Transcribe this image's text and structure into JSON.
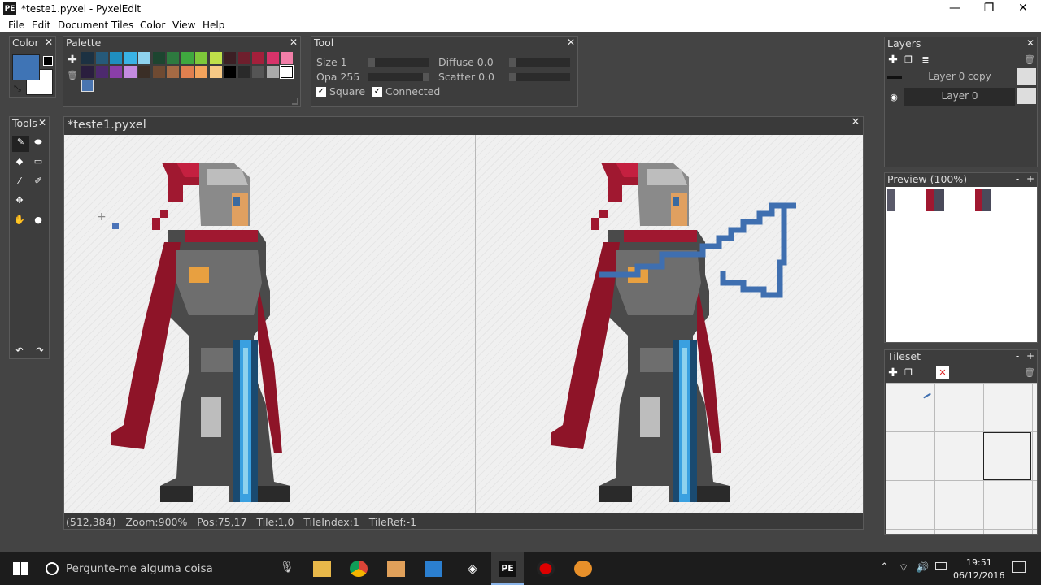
{
  "window": {
    "title": "*teste1.pyxel - PyxelEdit",
    "logo": "PE",
    "minimize": "—",
    "restore": "❐",
    "close": "✕"
  },
  "menu": [
    "File",
    "Edit",
    "Document",
    "Tiles",
    "Color",
    "View",
    "Help"
  ],
  "color_panel": {
    "title": "Color",
    "primary": "#3f74b5",
    "secondary": "#ffffff"
  },
  "palette_panel": {
    "title": "Palette",
    "selected": "#4a75b0",
    "row1": [
      "#1c3142",
      "#265a7a",
      "#1f8fc0",
      "#39b3e6",
      "#8ed2ee",
      "#1d4530",
      "#2d7a3f",
      "#3fa83f",
      "#7ec83a",
      "#bfe04a",
      "#3c1f24",
      "#6f1f2d",
      "#a3203b",
      "#d8336a",
      "#f27ea8"
    ],
    "row2": [
      "#2a1e3e",
      "#4d2a6e",
      "#8a3ea8",
      "#c48be0",
      "#3a2e26",
      "#6e4a32",
      "#a56a44",
      "#e07f4f",
      "#f4a35c",
      "#f6c985",
      "#000000",
      "#2a2a2a",
      "#555555",
      "#aaaaaa",
      "#ffffff"
    ]
  },
  "tool_panel": {
    "title": "Tool",
    "size": "Size 1",
    "opacity": "Opa 255",
    "diffuse": "Diffuse 0.0",
    "scatter": "Scatter 0.0",
    "square": "Square",
    "connected": "Connected",
    "square_checked": true,
    "connected_checked": true
  },
  "tools_panel": {
    "title": "Tools"
  },
  "document": {
    "title": "*teste1.pyxel"
  },
  "status": {
    "coords": "(512,384)",
    "zoom": "Zoom:900%",
    "pos": "Pos:75,17",
    "tile": "Tile:1,0",
    "tile_index": "TileIndex:1",
    "tile_ref": "TileRef:-1"
  },
  "layers_panel": {
    "title": "Layers",
    "layers": [
      "Layer 0 copy",
      "Layer 0"
    ]
  },
  "preview_panel": {
    "title": "Preview (100%)"
  },
  "tileset_panel": {
    "title": "Tileset"
  },
  "taskbar": {
    "search_placeholder": "Pergunte-me alguma coisa",
    "time": "19:51",
    "date": "06/12/2016"
  }
}
